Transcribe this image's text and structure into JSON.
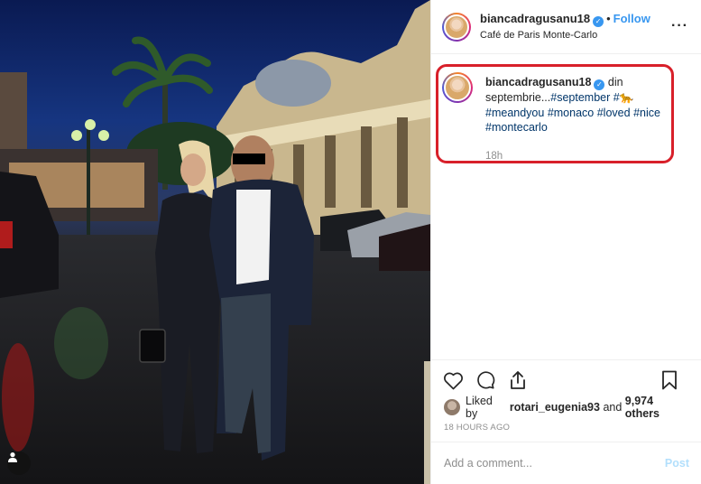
{
  "post": {
    "username": "biancadragusanu18",
    "verified_icon": "verified-badge-icon",
    "follow_label": "Follow",
    "separator": "•",
    "location": "Café de Paris Monte-Carlo",
    "more_label": "···"
  },
  "caption": {
    "username": "biancadragusanu18",
    "text_start": "din septembrie...",
    "emoji": "🐆",
    "hashtags": [
      "#september",
      "#meandyou",
      "#monaco",
      "#loved",
      "#nice",
      "#montecarlo"
    ],
    "age": "18h",
    "highlight_color": "#d8202a"
  },
  "actions": {
    "like_icon": "heart-icon",
    "comment_icon": "comment-icon",
    "share_icon": "share-icon",
    "save_icon": "bookmark-icon"
  },
  "likes": {
    "prefix": "Liked by ",
    "user": "rotari_eugenia93",
    "middle": " and ",
    "others": "9,974 others"
  },
  "timestamp": "18 HOURS AGO",
  "comment": {
    "placeholder": "Add a comment...",
    "post_label": "Post"
  },
  "colors": {
    "accent": "#3897f0",
    "post_disabled": "#b2dffc",
    "hashtag": "#003569",
    "muted": "#8e8e8e"
  }
}
